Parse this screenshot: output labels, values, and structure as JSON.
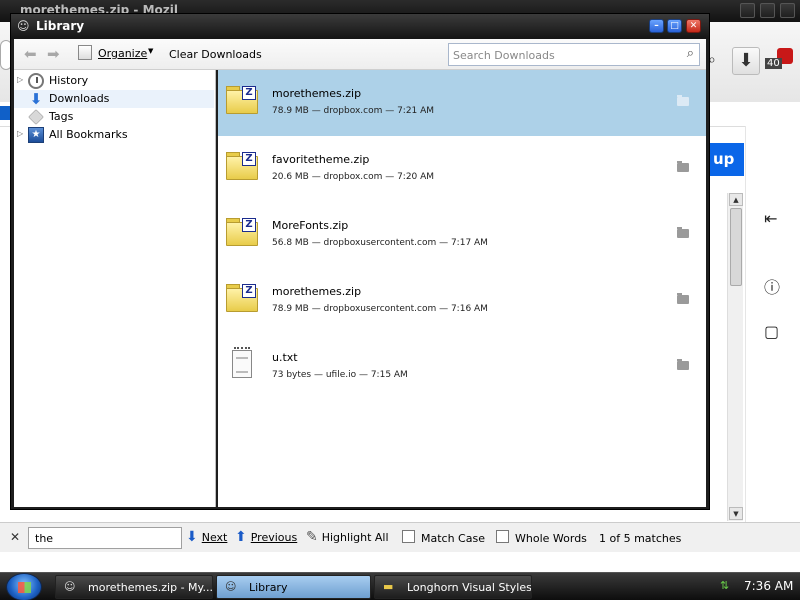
{
  "background_window": {
    "title": "morethemes.zip - Mozil"
  },
  "library": {
    "title": "Library",
    "toolbar": {
      "organize_label": "Organize",
      "clear_downloads_label": "Clear Downloads",
      "search_placeholder": "Search Downloads"
    },
    "tree": [
      {
        "label": "History",
        "icon": "history-clock-icon",
        "expandable": true
      },
      {
        "label": "Downloads",
        "icon": "downloads-arrow-icon",
        "expandable": false,
        "selected": true
      },
      {
        "label": "Tags",
        "icon": "tag-icon",
        "expandable": false
      },
      {
        "label": "All Bookmarks",
        "icon": "bookmarks-star-icon",
        "expandable": true
      }
    ],
    "downloads": [
      {
        "name": "morethemes.zip",
        "meta": "78.9 MB — dropbox.com — 7:21 AM",
        "type": "zip",
        "selected": true
      },
      {
        "name": "favoritetheme.zip",
        "meta": "20.6 MB — dropbox.com — 7:20 AM",
        "type": "zip",
        "selected": false
      },
      {
        "name": "MoreFonts.zip",
        "meta": "56.8 MB — dropboxusercontent.com — 7:17 AM",
        "type": "zip",
        "selected": false
      },
      {
        "name": "morethemes.zip",
        "meta": "78.9 MB — dropboxusercontent.com — 7:16 AM",
        "type": "zip",
        "selected": false
      },
      {
        "name": "u.txt",
        "meta": "73 bytes — ufile.io — 7:15 AM",
        "type": "txt",
        "selected": false
      }
    ]
  },
  "find_bar": {
    "query": "the",
    "next_label": "Next",
    "previous_label": "Previous",
    "highlight_all_label": "Highlight All",
    "match_case_label": "Match Case",
    "whole_words_label": "Whole Words",
    "matches_text": "1 of 5 matches"
  },
  "browser_fragments": {
    "button_fragment": "up",
    "download_count": "40"
  },
  "taskbar": {
    "tasks": [
      {
        "label": "morethemes.zip - My...",
        "active": false
      },
      {
        "label": "Library",
        "active": true
      },
      {
        "label": "Longhorn Visual Styles",
        "active": false
      }
    ],
    "clock": "7:36 AM"
  },
  "colors": {
    "selected_row": "#add1e8",
    "accent_blue": "#0a66e8",
    "title_bar": "#1e1e1e"
  }
}
